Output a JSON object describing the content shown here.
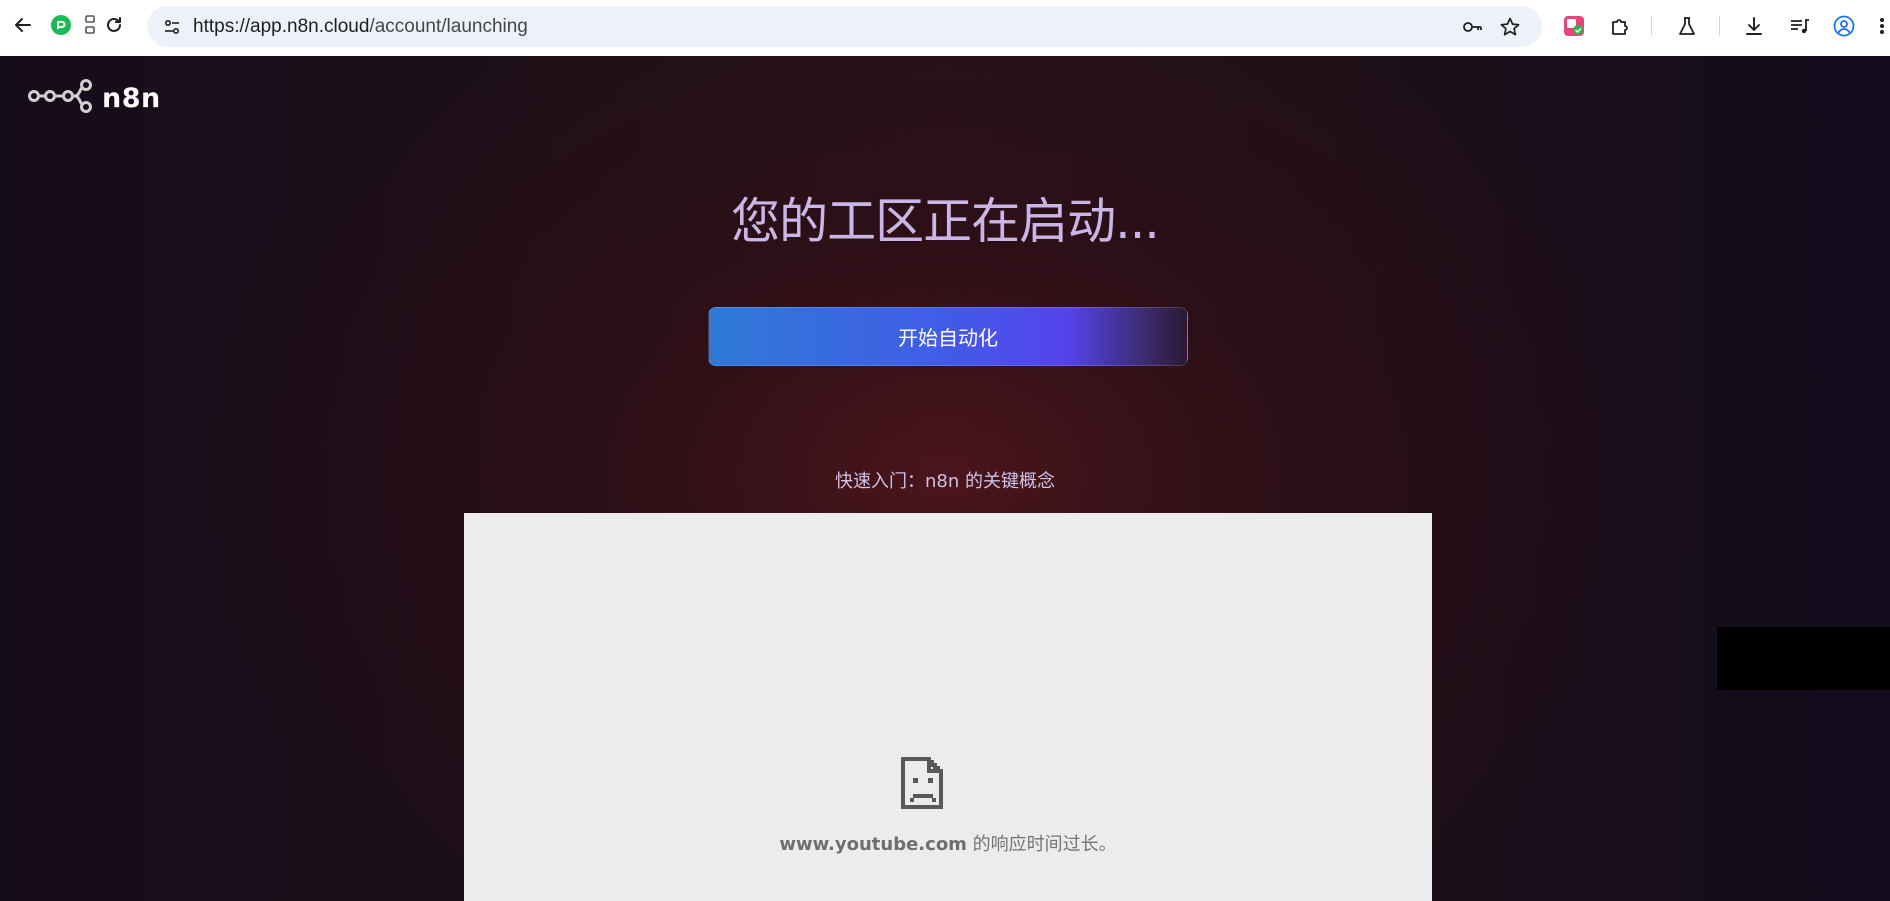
{
  "browser": {
    "url_host": "https://app.n8n.cloud",
    "url_path": "/account/launching"
  },
  "icons": {
    "back": "back-arrow-icon",
    "extension_green": "extension-icon",
    "split": "split-view-icon",
    "reload": "reload-icon",
    "site_info": "site-settings-icon",
    "password": "key-icon",
    "bookmark": "star-icon",
    "ext_translate": "translate-extension-icon",
    "extensions": "puzzle-icon",
    "labs": "flask-icon",
    "downloads": "download-icon",
    "media": "media-controls-icon",
    "profile": "profile-icon",
    "menu": "kebab-menu-icon",
    "logo": "n8n-logo-icon",
    "sad_page": "sad-page-icon"
  },
  "brand": {
    "name": "n8n"
  },
  "main": {
    "headline": "您的工区正在启动...",
    "cta_label": "开始自动化",
    "subtitle": "快速入门：n8n 的关键概念"
  },
  "embed": {
    "error_host": "www.youtube.com",
    "error_message": " 的响应时间过长。"
  },
  "colors": {
    "headline": "#c9b6e6",
    "cta_start": "#2f7ad6",
    "cta_end": "#5543ec",
    "frame_bg": "#ececec"
  }
}
